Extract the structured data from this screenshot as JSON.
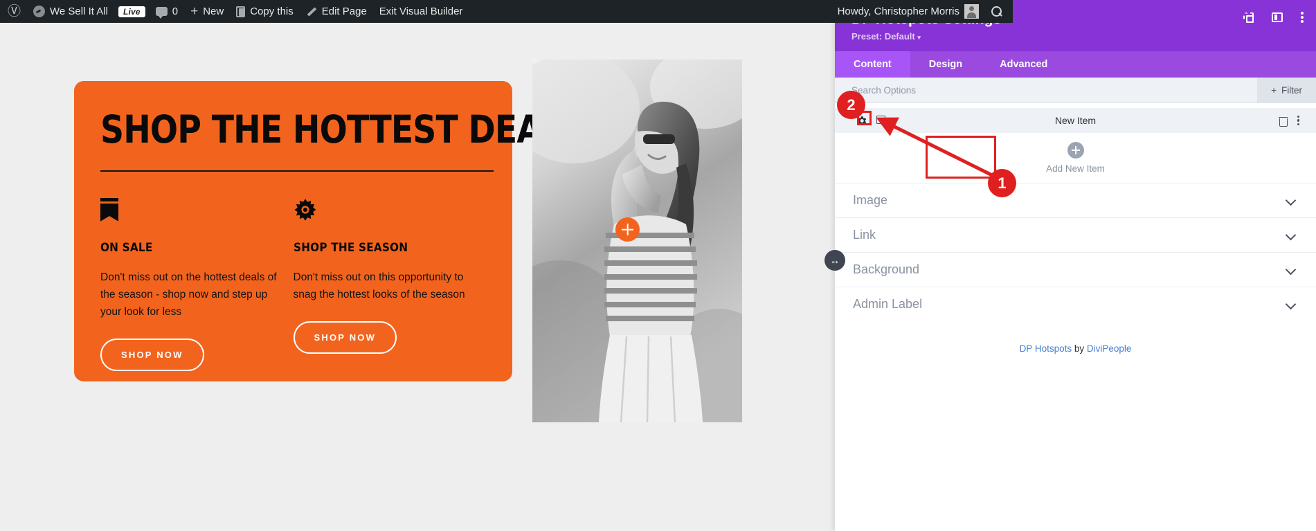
{
  "admin_bar": {
    "wp_logo_icon": "wordpress-logo-icon",
    "site_icon": "dashboard-icon",
    "site_name": "We Sell It All",
    "live_badge": "Live",
    "comments_icon": "comment-bubble-icon",
    "comments_count": "0",
    "new_icon": "plus-icon",
    "new_label": "New",
    "copy_icon": "copy-icon",
    "copy_label": "Copy this",
    "edit_icon": "pencil-icon",
    "edit_label": "Edit Page",
    "exit_label": "Exit Visual Builder",
    "howdy": "Howdy, Christopher Morris",
    "avatar_icon": "user-avatar-icon",
    "search_icon": "search-icon"
  },
  "promo": {
    "headline": "SHOP THE HOTTEST DEALS",
    "columns": [
      {
        "icon": "bookmark-icon",
        "heading": "ON SALE",
        "body": "Don't miss out on the hottest deals of the season - shop now and step up your look for less",
        "button": "SHOP NOW"
      },
      {
        "icon": "sun-icon",
        "heading": "SHOP THE SEASON",
        "body": "Don't miss out on this opportunity to snag the hottest looks of the season",
        "button": "SHOP NOW"
      }
    ],
    "card_color": "#f2641e"
  },
  "hotspot": {
    "marker_icon": "plus-hotspot-icon",
    "marker_color": "#f2641e"
  },
  "drag_handle": {
    "icon": "resize-horizontal-icon",
    "glyph": "↔"
  },
  "panel": {
    "title": "DP Hotspots Settings",
    "preset_label": "Preset: Default",
    "preset_caret": "▾",
    "header_icons": [
      "focus-icon",
      "layout-icon",
      "kebab-menu-icon"
    ],
    "accent_color": "#8833d7",
    "tabs": [
      {
        "label": "Content",
        "active": true
      },
      {
        "label": "Design",
        "active": false
      },
      {
        "label": "Advanced",
        "active": false
      }
    ],
    "search": {
      "placeholder": "Search Options",
      "value": ""
    },
    "filter_button": {
      "icon": "plus-icon",
      "label": "Filter"
    },
    "item_row": {
      "gear_icon": "gear-icon",
      "duplicate_icon": "duplicate-icon",
      "title": "New Item",
      "trash_icon": "trash-icon",
      "menu_icon": "kebab-menu-icon"
    },
    "add_new_item": {
      "icon": "plus-circle-icon",
      "label": "Add New Item"
    },
    "accordions": [
      {
        "label": "Image",
        "chevron": "chevron-down-icon"
      },
      {
        "label": "Link",
        "chevron": "chevron-down-icon"
      },
      {
        "label": "Background",
        "chevron": "chevron-down-icon"
      },
      {
        "label": "Admin Label",
        "chevron": "chevron-down-icon"
      }
    ],
    "credit": {
      "product": "DP Hotspots",
      "by": " by ",
      "vendor": "DiviPeople",
      "link_color": "#4a7fd4"
    }
  },
  "annotations": {
    "badge_1": "1",
    "badge_2": "2",
    "color": "#e02020"
  }
}
